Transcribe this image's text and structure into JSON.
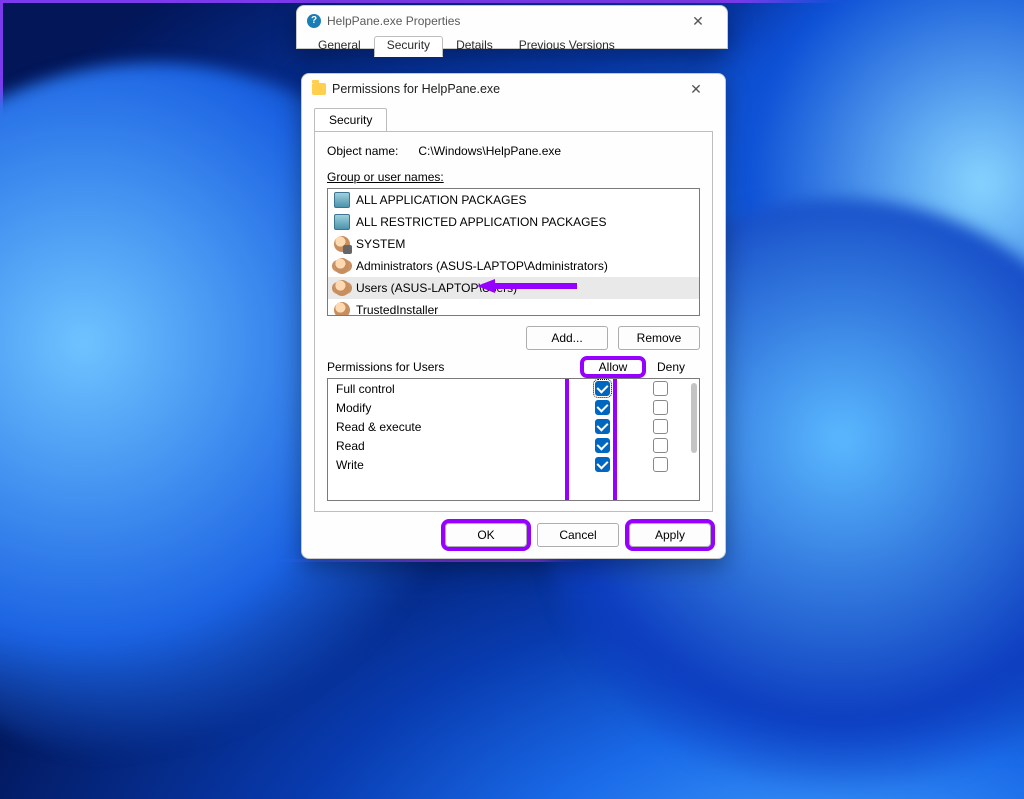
{
  "propsWindow": {
    "title": "HelpPane.exe Properties",
    "tabs": [
      "General",
      "Security",
      "Details",
      "Previous Versions"
    ],
    "activeTab": 1
  },
  "permWindow": {
    "title": "Permissions for HelpPane.exe",
    "tab": "Security",
    "objectNameLabel": "Object name:",
    "objectName": "C:\\Windows\\HelpPane.exe",
    "groupLabel": "Group or user names:",
    "groups": [
      {
        "name": "ALL APPLICATION PACKAGES",
        "icon": "pack"
      },
      {
        "name": "ALL RESTRICTED APPLICATION PACKAGES",
        "icon": "pack"
      },
      {
        "name": "SYSTEM",
        "icon": "sys"
      },
      {
        "name": "Administrators (ASUS-LAPTOP\\Administrators)",
        "icon": "users"
      },
      {
        "name": "Users (ASUS-LAPTOP\\Users)",
        "icon": "users",
        "selected": true
      },
      {
        "name": "TrustedInstaller",
        "icon": "user1"
      }
    ],
    "addLabel": "Add...",
    "removeLabel": "Remove",
    "permLabel": "Permissions for Users",
    "allowHead": "Allow",
    "denyHead": "Deny",
    "perms": [
      {
        "name": "Full control",
        "allow": true,
        "deny": false,
        "focus": true
      },
      {
        "name": "Modify",
        "allow": true,
        "deny": false
      },
      {
        "name": "Read & execute",
        "allow": true,
        "deny": false
      },
      {
        "name": "Read",
        "allow": true,
        "deny": false
      },
      {
        "name": "Write",
        "allow": true,
        "deny": false
      }
    ],
    "okLabel": "OK",
    "cancelLabel": "Cancel",
    "applyLabel": "Apply"
  }
}
